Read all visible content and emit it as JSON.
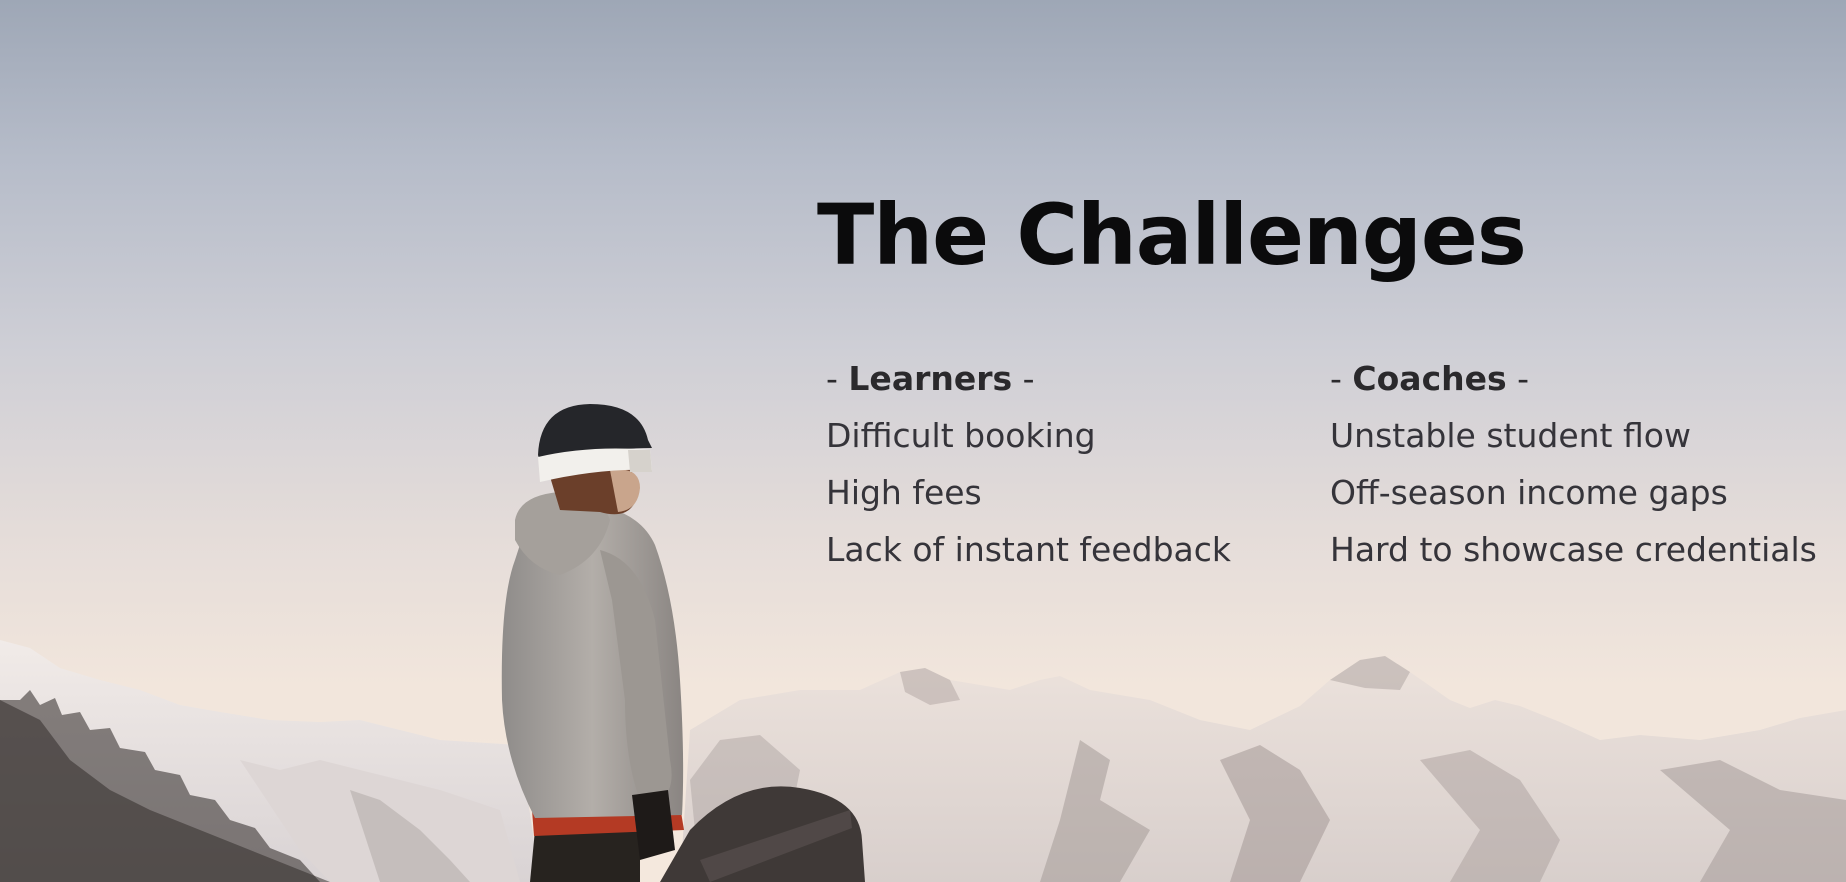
{
  "slide": {
    "title": "The Challenges",
    "background": {
      "image": "snowboarder-mountain-sunset-photo",
      "sky_top": "#9ea7b6",
      "sky_bottom": "#f4e8dd"
    },
    "columns": [
      {
        "prefix": "- ",
        "heading": "Learners",
        "suffix": " -",
        "items": [
          "Difficult booking",
          "High fees",
          "Lack of instant feedback"
        ]
      },
      {
        "prefix": "- ",
        "heading": "Coaches",
        "suffix": " -",
        "items": [
          "Unstable student flow",
          "Off-season income gaps",
          "Hard to showcase credentials"
        ]
      }
    ]
  }
}
